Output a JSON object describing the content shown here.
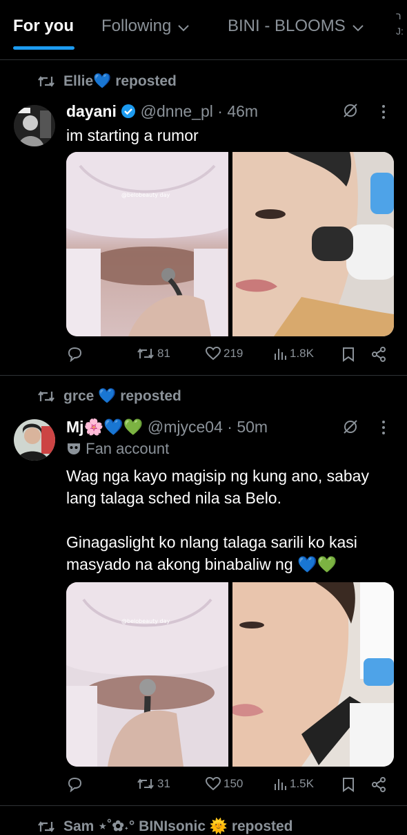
{
  "tabs": [
    {
      "label": "For you"
    },
    {
      "label": "Following"
    },
    {
      "label": "BINI - BLOOMS"
    }
  ],
  "tab_overflow": "ר\nJ:",
  "posts": [
    {
      "reposted_by": "Ellie",
      "reposted_suffix": "reposted",
      "author_name": "dayani",
      "handle": "@dnne_pl",
      "time": "46m",
      "text": "im starting a rumor",
      "watermark": "@belobeauty day",
      "replies": "",
      "reposts": "81",
      "likes": "219",
      "views": "1.8K"
    },
    {
      "reposted_by": "grce",
      "reposted_suffix": "reposted",
      "author_name": "Mj",
      "author_emoji": "🌸💙💚",
      "handle": "@mjyce04",
      "time": "50m",
      "label": "Fan account",
      "text1": "Wag nga kayo magisip ng kung ano, sabay lang talaga sched nila sa Belo.",
      "text2": "Ginagaslight ko nlang talaga sarili ko kasi masyado na akong binabaliw ng",
      "text2_emoji": "💙💚",
      "watermark": "@belobeauty day",
      "replies": "",
      "reposts": "31",
      "likes": "150",
      "views": "1.5K"
    }
  ],
  "next_repost": "Sam ⋆˚✿˖° BINIsonic 🌞 reposted",
  "colors": {
    "accent": "#1d9bf0",
    "muted": "#8b9299",
    "divider": "#2f3336",
    "verified": "#1d9bf0",
    "heart": "#1d9bf0",
    "green": "#2ecc40"
  }
}
